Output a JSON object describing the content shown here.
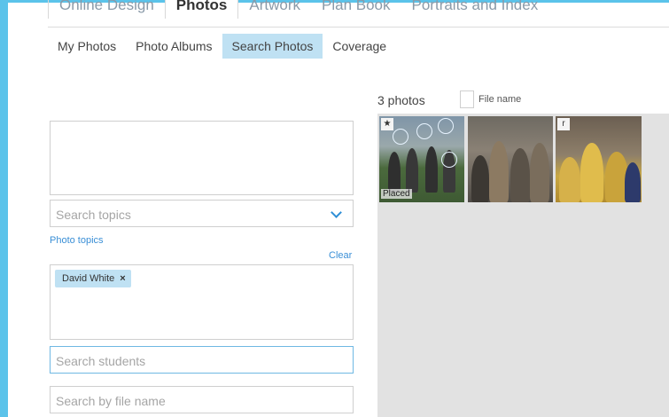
{
  "main_tabs": [
    "Online Design",
    "Photos",
    "Artwork",
    "Plan Book",
    "Portraits and Index"
  ],
  "main_tabs_active": "Photos",
  "sub_tabs": [
    "My Photos",
    "Photo Albums",
    "Search Photos",
    "Coverage"
  ],
  "sub_tabs_active": "Search Photos",
  "filters": {
    "topics_placeholder": "Search topics",
    "photo_topics_link": "Photo topics",
    "clear_link": "Clear",
    "selected_student": "David White",
    "chip_remove": "×",
    "students_placeholder": "Search students",
    "file_placeholder": "Search by file name"
  },
  "results": {
    "count_label": "3 photos",
    "file_name_label": "File name",
    "photos": [
      {
        "badge": "★",
        "status": "Placed"
      },
      {
        "badge": "",
        "status": ""
      },
      {
        "badge": "r",
        "status": ""
      }
    ]
  },
  "colors": {
    "accent": "#5bc3ea",
    "active_tab_bg": "#bfe1f3",
    "link": "#3a8fd6",
    "grid_bg": "#e2e2e2"
  }
}
